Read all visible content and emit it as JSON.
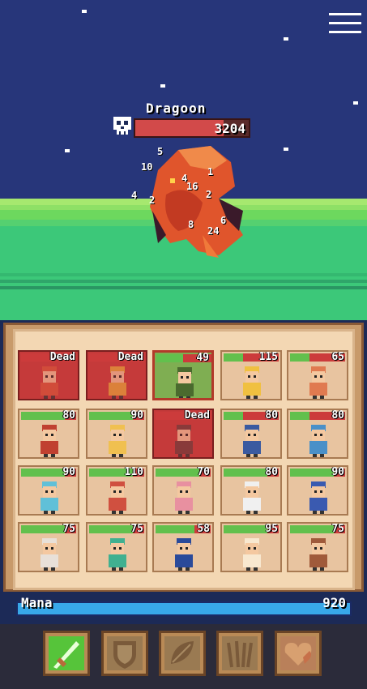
{
  "boss": {
    "name": "Dragoon",
    "hp": "3204",
    "hp_fraction": 0.78,
    "damage_numbers": [
      "5",
      "10",
      "1",
      "4",
      "16",
      "2",
      "4",
      "2",
      "8",
      "6",
      "24"
    ]
  },
  "party": [
    {
      "name": "dead-hero-1",
      "status": "Dead",
      "hp_fraction": 0
    },
    {
      "name": "dead-hero-2",
      "status": "Dead",
      "hp_fraction": 0
    },
    {
      "name": "goblin-archer",
      "status": "49",
      "hp_fraction": 0.49,
      "selected": true
    },
    {
      "name": "axe-warrior",
      "status": "115",
      "hp_fraction": 0.35
    },
    {
      "name": "golden-knight",
      "status": "65",
      "hp_fraction": 0.35
    },
    {
      "name": "red-hair-mage",
      "status": "80",
      "hp_fraction": 0.8
    },
    {
      "name": "blonde-priest",
      "status": "90",
      "hp_fraction": 0.8
    },
    {
      "name": "dead-hero-3",
      "status": "Dead",
      "hp_fraction": 0
    },
    {
      "name": "bald-monk",
      "status": "80",
      "hp_fraction": 0.35
    },
    {
      "name": "blue-hair-lancer",
      "status": "80",
      "hp_fraction": 0.35
    },
    {
      "name": "cyan-hair-fighter",
      "status": "90",
      "hp_fraction": 0.8
    },
    {
      "name": "red-hair-knight",
      "status": "110",
      "hp_fraction": 0.8
    },
    {
      "name": "pink-blob",
      "status": "70",
      "hp_fraction": 0.8
    },
    {
      "name": "white-masked-hero",
      "status": "80",
      "hp_fraction": 0.8
    },
    {
      "name": "blue-ninja",
      "status": "90",
      "hp_fraction": 0.8
    },
    {
      "name": "horned-warrior",
      "status": "75",
      "hp_fraction": 0.8
    },
    {
      "name": "green-hair-rogue",
      "status": "75",
      "hp_fraction": 0.8
    },
    {
      "name": "blue-hair-swordsman",
      "status": "58",
      "hp_fraction": 0.7
    },
    {
      "name": "cap-kid",
      "status": "95",
      "hp_fraction": 0.8
    },
    {
      "name": "brown-hair-fighter",
      "status": "75",
      "hp_fraction": 0.8
    }
  ],
  "mana": {
    "label": "Mana",
    "value": "920",
    "fraction": 1.0
  },
  "skills": [
    {
      "name": "slash-skill",
      "active": true
    },
    {
      "name": "shield-skill",
      "active": false
    },
    {
      "name": "leaf-skill",
      "active": false
    },
    {
      "name": "wheat-skill",
      "active": false
    },
    {
      "name": "heart-skill",
      "active": false
    }
  ],
  "colors": {
    "sky": "#27367a",
    "ground": "#3cc879",
    "hp_red": "#cc3b3b",
    "hp_green": "#62c04d",
    "mana": "#38a8e8"
  }
}
